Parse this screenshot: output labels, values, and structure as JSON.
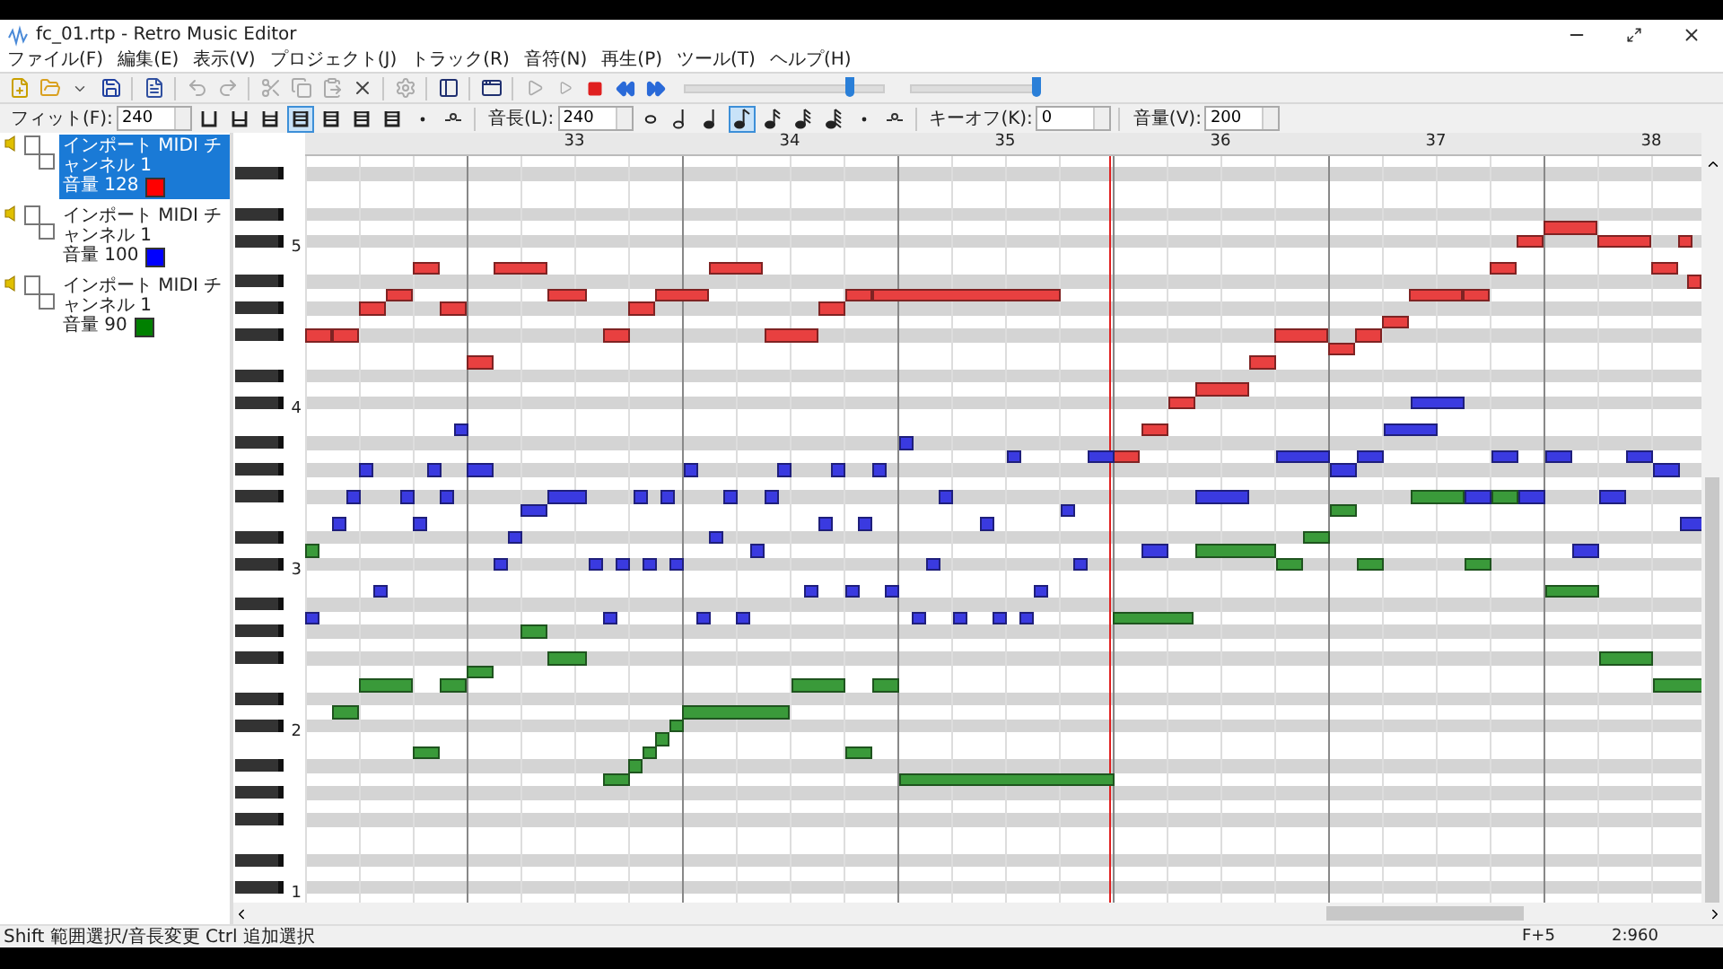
{
  "window": {
    "title": "fc_01.rtp - Retro Music Editor"
  },
  "menu": [
    "ファイル(F)",
    "編集(E)",
    "表示(V)",
    "プロジェクト(J)",
    "トラック(R)",
    "音符(N)",
    "再生(P)",
    "ツール(T)",
    "ヘルプ(H)"
  ],
  "toolbar": {
    "sliders": [
      {
        "level": 0.83
      },
      {
        "level": 0.98
      }
    ]
  },
  "note_toolbar": {
    "fit": {
      "label": "フィット(F):",
      "value": "240"
    },
    "fit_buttons": [
      {
        "selected": false
      },
      {
        "selected": false
      },
      {
        "selected": false
      },
      {
        "selected": true
      },
      {
        "selected": false
      },
      {
        "selected": false
      },
      {
        "selected": false
      }
    ],
    "length": {
      "label": "音長(L):",
      "value": "240"
    },
    "length_buttons": [
      {
        "selected": false
      },
      {
        "selected": false
      },
      {
        "selected": false
      },
      {
        "selected": true
      },
      {
        "selected": false
      },
      {
        "selected": false
      },
      {
        "selected": false
      }
    ],
    "key_off": {
      "label": "キーオフ(K):",
      "value": "0"
    },
    "volume": {
      "label": "音量(V):",
      "value": "200"
    }
  },
  "tracks": [
    {
      "name": "インポート MIDI チャンネル 1",
      "volume": "音量 128",
      "color": "#ff0000",
      "selected": true
    },
    {
      "name": "インポート MIDI チャンネル 1",
      "volume": "音量 100",
      "color": "#0000ff",
      "selected": false
    },
    {
      "name": "インポート MIDI チャンネル 1",
      "volume": "音量 90",
      "color": "#008000",
      "selected": false
    }
  ],
  "ruler": {
    "measures": [
      "33",
      "34",
      "35",
      "36",
      "37",
      "38"
    ]
  },
  "keyboard": {
    "octave_labels": [
      "5",
      "4",
      "3",
      "2",
      "1"
    ]
  },
  "status_bar": {
    "hint": "Shift 範囲選択/音長変更  Ctrl 追加選択",
    "position": "F+5",
    "time": "2:960"
  }
}
